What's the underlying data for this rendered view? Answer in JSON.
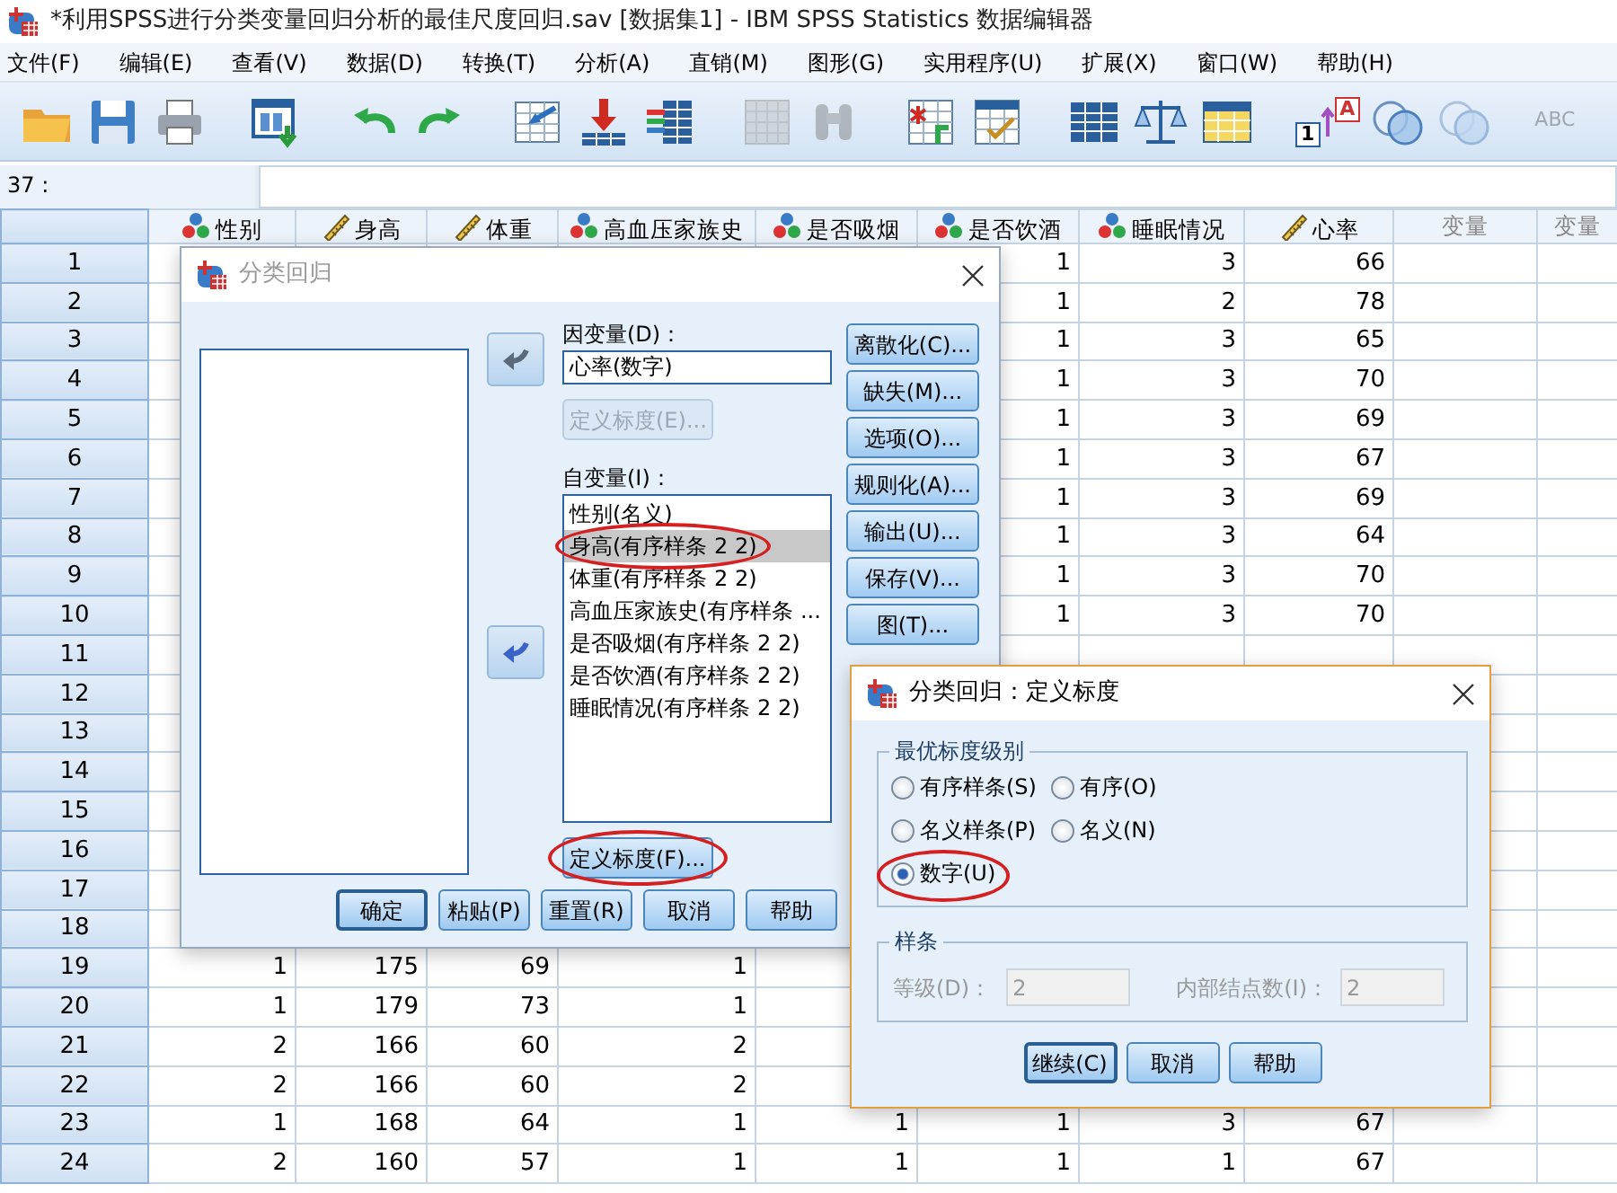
{
  "window": {
    "title": "*利用SPSS进行分类变量回归分析的最佳尺度回归.sav [数据集1] - IBM SPSS Statistics 数据编辑器"
  },
  "menu": [
    "文件(F)",
    "编辑(E)",
    "查看(V)",
    "数据(D)",
    "转换(T)",
    "分析(A)",
    "直销(M)",
    "图形(G)",
    "实用程序(U)",
    "扩展(X)",
    "窗口(W)",
    "帮助(H)"
  ],
  "toolbar": [
    {
      "kind": "folder",
      "disabled": false
    },
    {
      "kind": "floppy",
      "disabled": false
    },
    {
      "kind": "printer",
      "disabled": false
    },
    {
      "kind": "recall",
      "disabled": false
    },
    {
      "kind": "undo",
      "disabled": false
    },
    {
      "kind": "redo",
      "disabled": false
    },
    {
      "kind": "goto-case",
      "disabled": false
    },
    {
      "kind": "goto-variable",
      "disabled": false
    },
    {
      "kind": "variables",
      "disabled": false
    },
    {
      "kind": "mu",
      "disabled": true
    },
    {
      "kind": "binoculars",
      "disabled": true
    },
    {
      "kind": "insert-cases",
      "disabled": false
    },
    {
      "kind": "insert-variable",
      "disabled": false
    },
    {
      "kind": "split",
      "disabled": false
    },
    {
      "kind": "weight",
      "disabled": false
    },
    {
      "kind": "select",
      "disabled": false
    },
    {
      "kind": "value-labels",
      "disabled": false,
      "labels": [
        "A",
        "1"
      ]
    },
    {
      "kind": "sets",
      "disabled": false
    },
    {
      "kind": "sets",
      "disabled": true
    },
    {
      "kind": "spell",
      "disabled": true,
      "label": "ABC"
    }
  ],
  "cell_ref": "37 :",
  "grid": {
    "columns": [
      {
        "label": "性别",
        "kind": "nominal"
      },
      {
        "label": "身高",
        "kind": "scale"
      },
      {
        "label": "体重",
        "kind": "scale"
      },
      {
        "label": "高血压家族史",
        "kind": "nominal"
      },
      {
        "label": "是否吸烟",
        "kind": "nominal"
      },
      {
        "label": "是否饮酒",
        "kind": "nominal"
      },
      {
        "label": "睡眠情况",
        "kind": "nominal"
      },
      {
        "label": "心率",
        "kind": "scale"
      },
      {
        "label": "变量",
        "kind": "empty"
      },
      {
        "label": "变量",
        "kind": "empty"
      }
    ],
    "rows": [
      {
        "number": "1",
        "cells": [
          null,
          null,
          null,
          null,
          null,
          "1",
          "3",
          "66",
          null,
          null
        ]
      },
      {
        "number": "2",
        "cells": [
          null,
          null,
          null,
          null,
          null,
          "1",
          "2",
          "78",
          null,
          null
        ]
      },
      {
        "number": "3",
        "cells": [
          null,
          null,
          null,
          null,
          null,
          "1",
          "3",
          "65",
          null,
          null
        ]
      },
      {
        "number": "4",
        "cells": [
          null,
          null,
          null,
          null,
          null,
          "1",
          "3",
          "70",
          null,
          null
        ]
      },
      {
        "number": "5",
        "cells": [
          null,
          null,
          null,
          null,
          null,
          "1",
          "3",
          "69",
          null,
          null
        ]
      },
      {
        "number": "6",
        "cells": [
          null,
          null,
          null,
          null,
          null,
          "1",
          "3",
          "67",
          null,
          null
        ]
      },
      {
        "number": "7",
        "cells": [
          null,
          null,
          null,
          null,
          null,
          "1",
          "3",
          "69",
          null,
          null
        ]
      },
      {
        "number": "8",
        "cells": [
          null,
          null,
          null,
          null,
          null,
          "1",
          "3",
          "64",
          null,
          null
        ]
      },
      {
        "number": "9",
        "cells": [
          null,
          null,
          null,
          null,
          null,
          "1",
          "3",
          "70",
          null,
          null
        ]
      },
      {
        "number": "10",
        "cells": [
          null,
          null,
          null,
          null,
          null,
          "1",
          "3",
          "70",
          null,
          null
        ]
      },
      {
        "number": "11",
        "cells": [
          null,
          null,
          null,
          null,
          null,
          null,
          null,
          null,
          null,
          null
        ]
      },
      {
        "number": "12",
        "cells": [
          null,
          null,
          null,
          null,
          null,
          null,
          null,
          null,
          null,
          null
        ]
      },
      {
        "number": "13",
        "cells": [
          null,
          null,
          null,
          null,
          null,
          null,
          null,
          null,
          null,
          null
        ]
      },
      {
        "number": "14",
        "cells": [
          null,
          null,
          null,
          null,
          null,
          null,
          null,
          null,
          null,
          null
        ]
      },
      {
        "number": "15",
        "cells": [
          null,
          null,
          null,
          null,
          null,
          null,
          null,
          null,
          null,
          null
        ]
      },
      {
        "number": "16",
        "cells": [
          null,
          null,
          null,
          null,
          null,
          null,
          null,
          null,
          null,
          null
        ]
      },
      {
        "number": "17",
        "cells": [
          null,
          null,
          null,
          null,
          null,
          null,
          null,
          null,
          null,
          null
        ]
      },
      {
        "number": "18",
        "cells": [
          null,
          null,
          null,
          null,
          null,
          null,
          null,
          null,
          null,
          null
        ]
      },
      {
        "number": "19",
        "cells": [
          "1",
          "175",
          "69",
          "1",
          null,
          null,
          null,
          null,
          null,
          null
        ]
      },
      {
        "number": "20",
        "cells": [
          "1",
          "179",
          "73",
          "1",
          null,
          null,
          null,
          null,
          null,
          null
        ]
      },
      {
        "number": "21",
        "cells": [
          "2",
          "166",
          "60",
          "2",
          null,
          null,
          null,
          null,
          null,
          null
        ]
      },
      {
        "number": "22",
        "cells": [
          "2",
          "166",
          "60",
          "2",
          null,
          null,
          null,
          null,
          null,
          null
        ]
      },
      {
        "number": "23",
        "cells": [
          "1",
          "168",
          "64",
          "1",
          "1",
          "1",
          "3",
          "67",
          null,
          null
        ]
      },
      {
        "number": "24",
        "cells": [
          "2",
          "160",
          "57",
          "1",
          "1",
          "1",
          "1",
          "67",
          null,
          null
        ]
      }
    ]
  },
  "dialog": {
    "title": "分类回归",
    "active": false,
    "arrows": [
      {
        "disabled": true
      },
      {
        "disabled": false
      }
    ],
    "dependent_label": "因变量(D)：",
    "dependent_value": "心率(数字)",
    "dependent_scale_button": {
      "label": "定义标度(E)...",
      "disabled": true
    },
    "independent_label": "自变量(I)：",
    "independents": [
      {
        "label": "性别(名义)",
        "selected": false,
        "circled": false
      },
      {
        "label": "身高(有序样条 2 2)",
        "selected": true,
        "circled": true
      },
      {
        "label": "体重(有序样条 2 2)",
        "selected": false,
        "circled": false
      },
      {
        "label": "高血压家族史(有序样条 ...",
        "selected": false,
        "circled": false
      },
      {
        "label": "是否吸烟(有序样条 2 2)",
        "selected": false,
        "circled": false
      },
      {
        "label": "是否饮酒(有序样条 2 2)",
        "selected": false,
        "circled": false
      },
      {
        "label": "睡眠情况(有序样条 2 2)",
        "selected": false,
        "circled": false
      }
    ],
    "independent_scale_button": {
      "label": "定义标度(F)...",
      "disabled": false,
      "circled": true
    },
    "side_buttons": [
      "离散化(C)...",
      "缺失(M)...",
      "选项(O)...",
      "规则化(A)...",
      "输出(U)...",
      "保存(V)...",
      "图(T)..."
    ],
    "buttons": [
      {
        "label": "确定",
        "default": true
      },
      {
        "label": "粘贴(P)",
        "default": false
      },
      {
        "label": "重置(R)",
        "default": false
      },
      {
        "label": "取消",
        "default": false
      },
      {
        "label": "帮助",
        "default": false
      }
    ]
  },
  "scale_dialog": {
    "title": "分类回归：定义标度",
    "active": true,
    "level_group": "最优标度级别",
    "levels": [
      {
        "label": "有序样条(S)",
        "selected": false,
        "circled": false
      },
      {
        "label": "有序(O)",
        "selected": false,
        "circled": false
      },
      {
        "label": "名义样条(P)",
        "selected": false,
        "circled": false
      },
      {
        "label": "名义(N)",
        "selected": false,
        "circled": false
      },
      {
        "label": "数字(U)",
        "selected": true,
        "circled": true
      }
    ],
    "spline_group": "样条",
    "spline_disabled": true,
    "degree_label": "等级(D)：",
    "degree_value": "2",
    "knots_label": "内部结点数(I)：",
    "knots_value": "2",
    "buttons": [
      {
        "label": "继续(C)",
        "default": true
      },
      {
        "label": "取消",
        "default": false
      },
      {
        "label": "帮助",
        "default": false
      }
    ]
  }
}
